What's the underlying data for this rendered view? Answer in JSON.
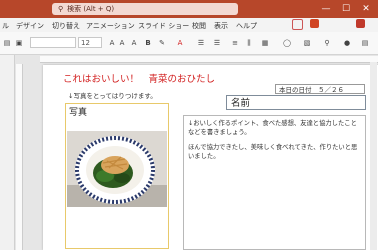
{
  "app": {
    "search_placeholder": "検索 (Alt + Q)"
  },
  "window": {
    "minimize_glyph": "—",
    "maximize_glyph": "☐",
    "close_glyph": "✕"
  },
  "menu": {
    "items": [
      "ル",
      "デザイン",
      "切り替え",
      "アニメーション",
      "スライド ショー",
      "校閲",
      "表示",
      "ヘルプ"
    ]
  },
  "ribbon": {
    "font_size": "12",
    "font_name": ""
  },
  "slide": {
    "title": "これはおいしい！　青菜のおひたし",
    "date_label": "本日の日付　５／２６",
    "note": "↓写真をとってはりつけます。",
    "name_label": "名前",
    "photo_label": "写真",
    "paragraphs": [
      "↓おいしく作るポイント、食べた感想、友達と協力したことなどを書きましょう。",
      "ほんで協力できたし、美味しく食べれてきた、作りたいと思いました。"
    ]
  },
  "colors": {
    "brand": "#b7472a",
    "title_red": "#d21f1f"
  }
}
